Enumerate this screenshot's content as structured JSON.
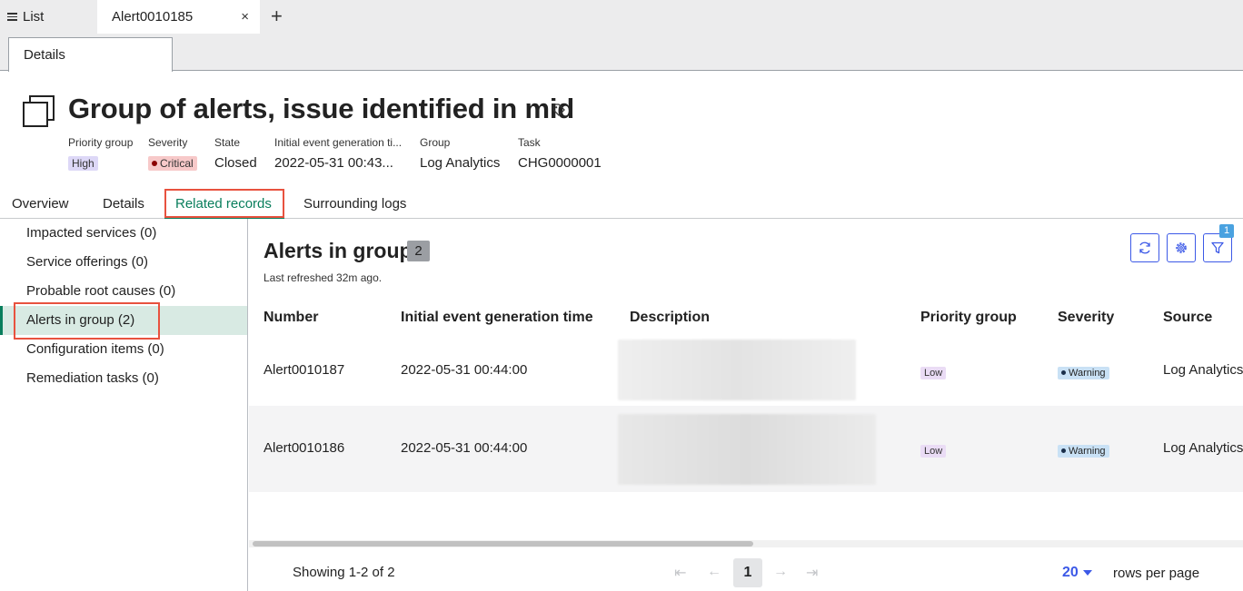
{
  "tabs": {
    "list_label": "List",
    "active_label": "Alert0010185",
    "close_glyph": "×",
    "add_glyph": "+"
  },
  "subtab": {
    "details_label": "Details"
  },
  "header": {
    "title": "Group of alerts, issue identified in mid",
    "meta": [
      {
        "label": "Priority group",
        "value": "High"
      },
      {
        "label": "Severity",
        "value": "Critical"
      },
      {
        "label": "State",
        "value": "Closed"
      },
      {
        "label": "Initial event generation ti...",
        "value": "2022-05-31 00:43..."
      },
      {
        "label": "Group",
        "value": "Log Analytics"
      },
      {
        "label": "Task",
        "value": "CHG0000001"
      }
    ]
  },
  "record_tabs": [
    "Overview",
    "Details",
    "Related records",
    "Surrounding logs"
  ],
  "sidebar": {
    "items": [
      "Impacted services (0)",
      "Service offerings (0)",
      "Probable root causes (0)",
      "Alerts in group (2)",
      "Configuration items (0)",
      "Remediation tasks (0)"
    ]
  },
  "panel": {
    "title": "Alerts in group",
    "count": "2",
    "last_refreshed": "Last refreshed 32m ago.",
    "filter_count": "1",
    "icons": [
      "refresh-icon",
      "gear-icon",
      "filter-icon"
    ]
  },
  "table": {
    "columns": [
      "Number",
      "Initial event generation time",
      "Description",
      "Priority group",
      "Severity",
      "Source"
    ],
    "rows": [
      {
        "number": "Alert0010187",
        "time": "2022-05-31 00:44:00",
        "priority": "Low",
        "severity": "Warning",
        "source": "Log Analytics"
      },
      {
        "number": "Alert0010186",
        "time": "2022-05-31 00:44:00",
        "priority": "Low",
        "severity": "Warning",
        "source": "Log Analytics"
      }
    ]
  },
  "pagination": {
    "showing": "Showing 1-2 of 2",
    "current_page": "1",
    "rows_per_page": "20",
    "rows_per_page_label": "rows per page"
  },
  "colors": {
    "accent_green": "#097e5c",
    "link_blue": "#3c59e7",
    "highlight_red": "#e8523f"
  }
}
